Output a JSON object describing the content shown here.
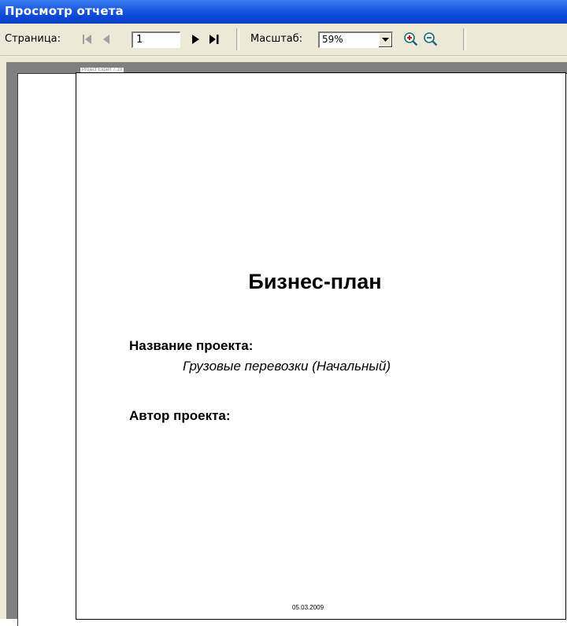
{
  "window": {
    "title": "Просмотр отчета"
  },
  "toolbar": {
    "page_label": "Страница:",
    "page_value": "1",
    "zoom_label": "Масштаб:",
    "zoom_value": "59%",
    "buttons": {
      "first": "first-page-icon",
      "prev": "previous-page-icon",
      "next": "next-page-icon",
      "last": "last-page-icon",
      "zoom_in": "zoom-in-icon",
      "zoom_out": "zoom-out-icon"
    }
  },
  "document": {
    "header": "Project Expert 7.19",
    "title": "Бизнес-план",
    "project_label": "Название проекта:",
    "project_name": "Грузовые перевозки (Начальный)",
    "author_label": "Автор проекта:",
    "footer_date": "05.03.2009"
  },
  "colors": {
    "titlebar": "#0a48d8",
    "toolbar_bg": "#ece9d8",
    "preview_bg": "#808080",
    "page_bg": "#ffffff"
  }
}
